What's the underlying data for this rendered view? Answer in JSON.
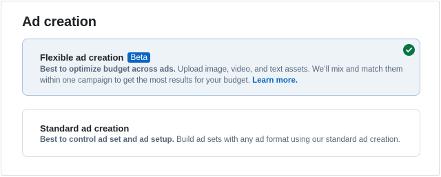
{
  "section": {
    "title": "Ad creation"
  },
  "options": [
    {
      "title": "Flexible ad creation",
      "badge": "Beta",
      "desc_bold": "Best to optimize budget across ads.",
      "desc_text": " Upload image, video, and text assets. We’ll mix and match them within one campaign to get the most results for your budget. ",
      "link": "Learn more.",
      "selected": true,
      "status_icon": "check-circle-icon"
    },
    {
      "title": "Standard ad creation",
      "desc_bold": "Best to control ad set and ad setup.",
      "desc_text": " Build ad sets with any ad format using our standard ad creation.",
      "selected": false
    }
  ],
  "colors": {
    "accent": "#0a66c2",
    "selected_bg": "#eef3f8",
    "selected_border": "#a8c4e0",
    "success": "#057642"
  }
}
